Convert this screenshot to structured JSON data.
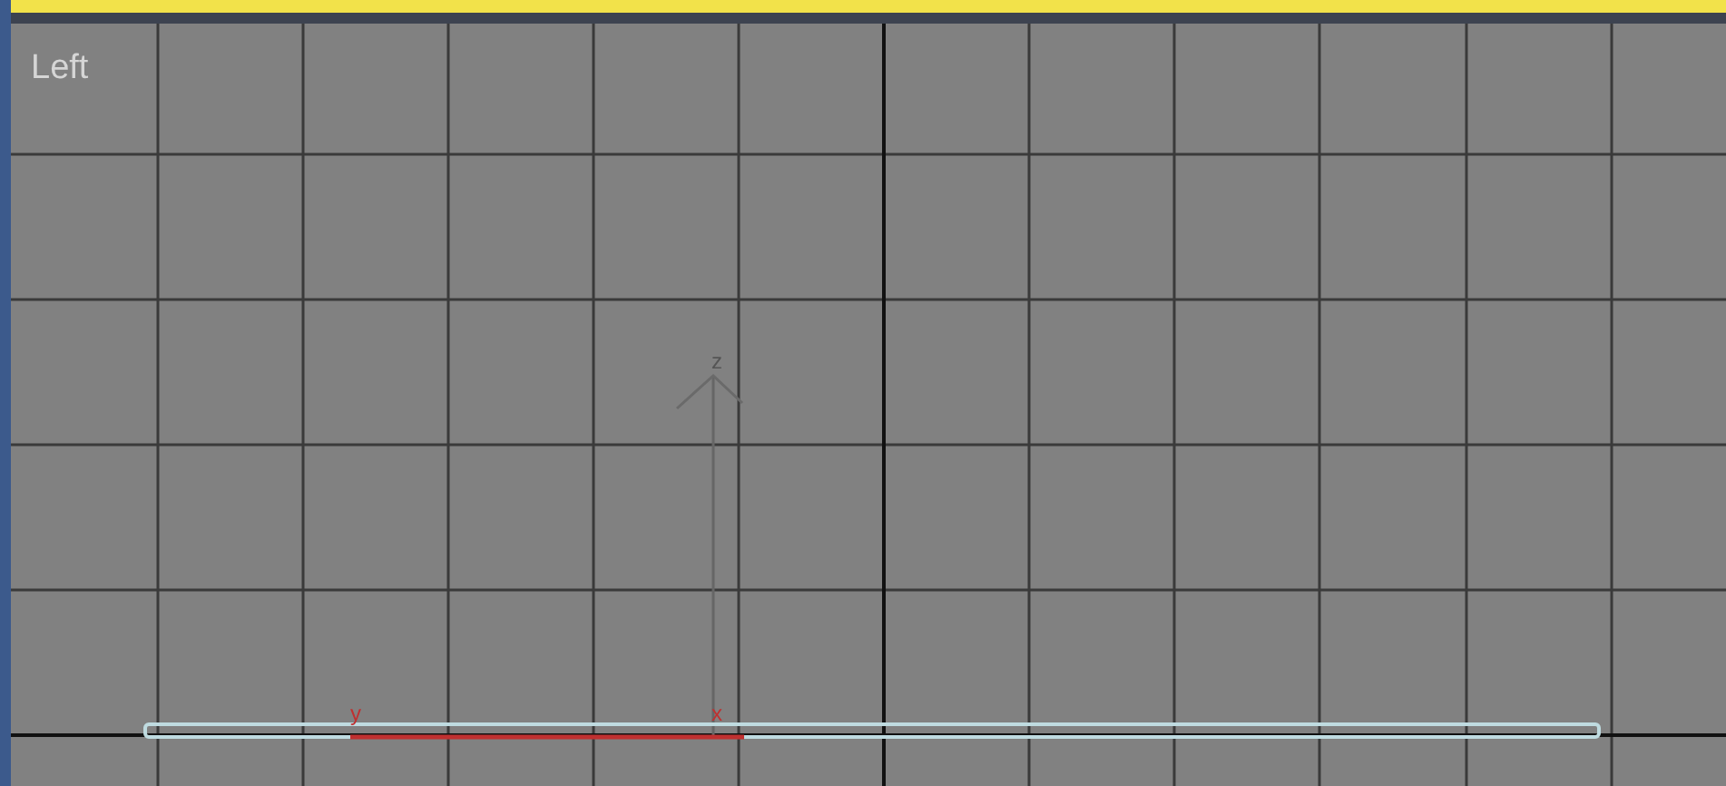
{
  "viewport": {
    "label": "Left",
    "active": true
  },
  "world_axis": {
    "label": "z"
  },
  "object_axes": [
    {
      "label": "y"
    },
    {
      "label": "x"
    }
  ]
}
